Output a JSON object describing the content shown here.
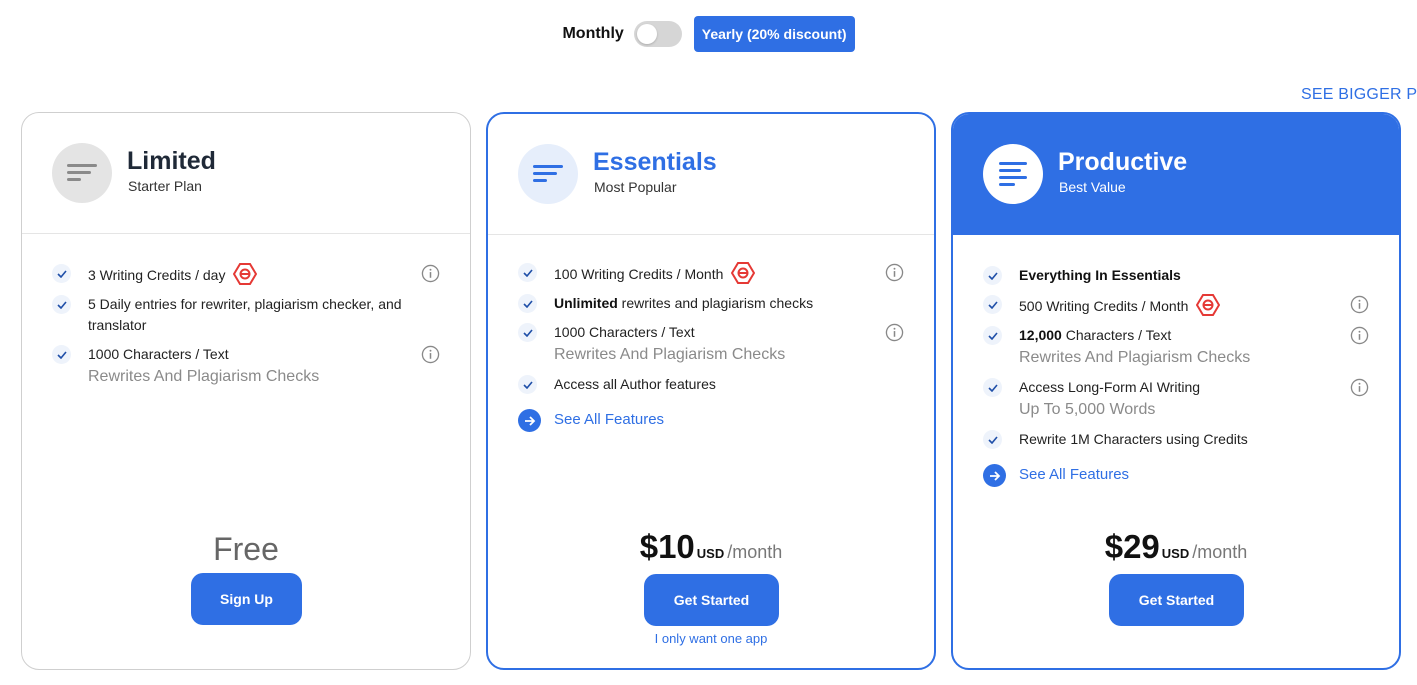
{
  "billing": {
    "monthly_label": "Monthly",
    "toggle_state": "off",
    "yearly_label": "Yearly (20% discount)"
  },
  "see_bigger_label": "SEE BIGGER PLA",
  "colors": {
    "accent": "#2f6fe4",
    "credit_badge": "#e53935"
  },
  "plans": {
    "limited": {
      "name": "Limited",
      "subtitle": "Starter Plan",
      "icon": "lines-icon",
      "features": [
        {
          "text": "3 Writing Credits / day",
          "credit_icon": true,
          "info": true
        },
        {
          "text": "5 Daily entries for rewriter, plagiarism checker, and translator"
        },
        {
          "text": "1000 Characters / Text",
          "sub": "Rewrites And Plagiarism Checks",
          "info": true
        }
      ],
      "price_label": "Free",
      "cta": "Sign Up"
    },
    "essentials": {
      "name": "Essentials",
      "subtitle": "Most Popular",
      "icon": "lines-icon",
      "features": [
        {
          "text": "100 Writing Credits / Month",
          "credit_icon": true,
          "info": true
        },
        {
          "bold": "Unlimited",
          "text": "rewrites and plagiarism checks"
        },
        {
          "text": "1000 Characters / Text",
          "sub": "Rewrites And Plagiarism Checks",
          "info": true
        },
        {
          "text": "Access all Author features"
        }
      ],
      "see_all": "See All Features",
      "price": "$10",
      "currency": "USD",
      "period": "/month",
      "cta": "Get Started",
      "secondary_link": "I only want one app"
    },
    "productive": {
      "name": "Productive",
      "subtitle": "Best Value",
      "icon": "lines-icon",
      "features": [
        {
          "bold": "Everything In Essentials"
        },
        {
          "text": "500 Writing Credits / Month",
          "credit_icon": true,
          "info": true
        },
        {
          "bold": "12,000",
          "text": "Characters / Text",
          "sub": "Rewrites And Plagiarism Checks",
          "info": true
        },
        {
          "text": "Access Long-Form AI Writing",
          "sub": "Up To 5,000 Words",
          "info": true
        },
        {
          "text": "Rewrite 1M Characters using Credits"
        }
      ],
      "see_all": "See All Features",
      "price": "$29",
      "currency": "USD",
      "period": "/month",
      "cta": "Get Started"
    }
  }
}
